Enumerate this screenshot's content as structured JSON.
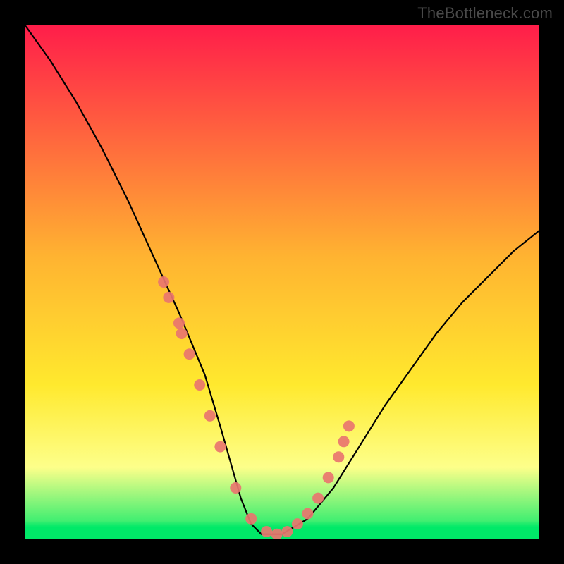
{
  "watermark": "TheBottleneck.com",
  "chart_data": {
    "type": "line",
    "title": "",
    "xlabel": "",
    "ylabel": "",
    "xlim": [
      0,
      100
    ],
    "ylim": [
      0,
      100
    ],
    "series": [
      {
        "name": "bottleneck-curve",
        "x": [
          0,
          5,
          10,
          15,
          20,
          25,
          30,
          35,
          38,
          40,
          42,
          44,
          46,
          50,
          55,
          60,
          65,
          70,
          75,
          80,
          85,
          90,
          95,
          100
        ],
        "y": [
          100,
          93,
          85,
          76,
          66,
          55,
          44,
          32,
          22,
          15,
          8,
          3,
          1,
          1,
          4,
          10,
          18,
          26,
          33,
          40,
          46,
          51,
          56,
          60
        ]
      }
    ],
    "markers": [
      {
        "x": 27,
        "y": 50
      },
      {
        "x": 28,
        "y": 47
      },
      {
        "x": 30,
        "y": 42
      },
      {
        "x": 30.5,
        "y": 40
      },
      {
        "x": 32,
        "y": 36
      },
      {
        "x": 34,
        "y": 30
      },
      {
        "x": 36,
        "y": 24
      },
      {
        "x": 38,
        "y": 18
      },
      {
        "x": 41,
        "y": 10
      },
      {
        "x": 44,
        "y": 4
      },
      {
        "x": 47,
        "y": 1.5
      },
      {
        "x": 49,
        "y": 1
      },
      {
        "x": 51,
        "y": 1.5
      },
      {
        "x": 53,
        "y": 3
      },
      {
        "x": 55,
        "y": 5
      },
      {
        "x": 57,
        "y": 8
      },
      {
        "x": 59,
        "y": 12
      },
      {
        "x": 61,
        "y": 16
      },
      {
        "x": 62,
        "y": 19
      },
      {
        "x": 63,
        "y": 22
      }
    ],
    "background": {
      "type": "vertical-gradient",
      "stops": [
        {
          "pos": 0,
          "color": "#ff1d4a"
        },
        {
          "pos": 45,
          "color": "#ffb331"
        },
        {
          "pos": 70,
          "color": "#ffe92e"
        },
        {
          "pos": 86,
          "color": "#fdff8a"
        },
        {
          "pos": 100,
          "color": "#00e968"
        }
      ],
      "green_band_top_pct": 96.5,
      "green_band_height_pct": 3.5
    }
  }
}
